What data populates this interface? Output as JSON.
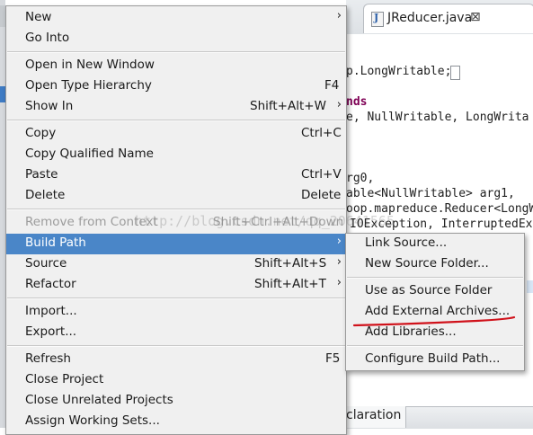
{
  "editor": {
    "tab_title": "JReducer.java",
    "tab_close": "⊠",
    "code_lines": [
      "p.LongWritable;",
      "nds",
      "e, NullWritable, LongWrita",
      "rg0,",
      "able<NullWritable> arg1,",
      "oop.mapreduce.Reducer<LongW",
      "IOException, InterruptedEx"
    ],
    "bottom_tab": "claration"
  },
  "context_menu": {
    "items": [
      {
        "label": "New",
        "arrow": "›"
      },
      {
        "label": "Go Into"
      },
      {
        "label": "Open in New Window"
      },
      {
        "label": "Open Type Hierarchy",
        "shortcut": "F4"
      },
      {
        "label": "Show In",
        "shortcut": "Shift+Alt+W",
        "arrow": "›"
      },
      {
        "label": "Copy",
        "shortcut": "Ctrl+C"
      },
      {
        "label": "Copy Qualified Name"
      },
      {
        "label": "Paste",
        "shortcut": "Ctrl+V"
      },
      {
        "label": "Delete",
        "shortcut": "Delete"
      },
      {
        "label": "Remove from Context",
        "shortcut": "Shift+Ctrl+Alt+Down"
      },
      {
        "label": "Build Path",
        "arrow": "›"
      },
      {
        "label": "Source",
        "shortcut": "Shift+Alt+S",
        "arrow": "›"
      },
      {
        "label": "Refactor",
        "shortcut": "Shift+Alt+T",
        "arrow": "›"
      },
      {
        "label": "Import..."
      },
      {
        "label": "Export..."
      },
      {
        "label": "Refresh",
        "shortcut": "F5"
      },
      {
        "label": "Close Project"
      },
      {
        "label": "Close Unrelated Projects"
      },
      {
        "label": "Assign Working Sets..."
      }
    ]
  },
  "submenu": {
    "items": [
      {
        "label": "Link Source..."
      },
      {
        "label": "New Source Folder..."
      },
      {
        "label": "Use as Source Folder"
      },
      {
        "label": "Add External Archives..."
      },
      {
        "label": "Add Libraries..."
      },
      {
        "label": "Configure Build Path..."
      }
    ]
  },
  "watermark": "http://blog.csdn.net/qq_20641565",
  "colors": {
    "selection": "#4a86c8",
    "annotation": "#d0121b",
    "keyword": "#7f0055"
  }
}
